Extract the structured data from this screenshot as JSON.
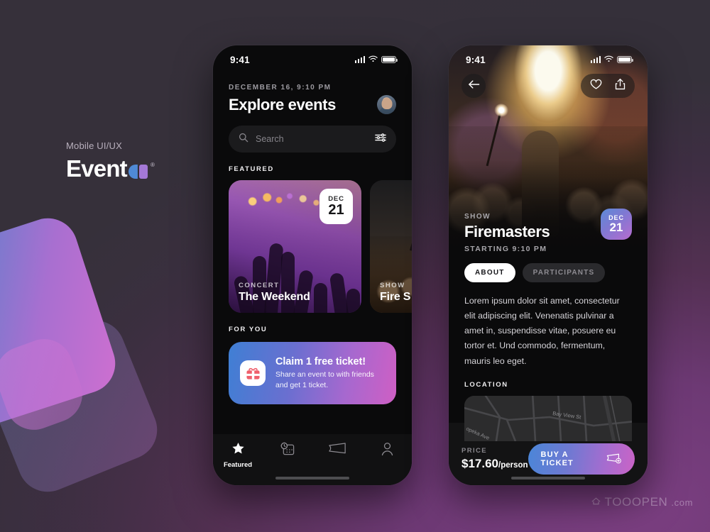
{
  "brand": {
    "kicker": "Mobile UI/UX",
    "name": "Event",
    "registered": "®"
  },
  "watermark": {
    "icon": "cloud-home-icon",
    "name": "TOOOPEN",
    "suffix": ".com"
  },
  "phone_explore": {
    "statusbar": {
      "time": "9:41",
      "signal_icon": "cellular-signal-icon",
      "wifi_icon": "wifi-icon",
      "battery_icon": "battery-icon"
    },
    "header": {
      "date": "DECEMBER 16, 9:10 PM",
      "title": "Explore events",
      "avatar": "user-avatar"
    },
    "search": {
      "placeholder": "Search",
      "search_icon": "search-icon",
      "filter_icon": "filter-sliders-icon"
    },
    "featured": {
      "label": "FEATURED",
      "cards": [
        {
          "kicker": "CONCERT",
          "name": "The Weekend",
          "date_month": "DEC",
          "date_day": "21"
        },
        {
          "kicker": "SHOW",
          "name": "Fire S"
        }
      ]
    },
    "for_you": {
      "label": "FOR YOU",
      "promo": {
        "icon": "gift-ticket-icon",
        "title": "Claim 1 free ticket!",
        "subtitle": "Share an event to with friends and get 1 ticket."
      }
    },
    "tabbar": {
      "items": [
        {
          "icon": "star-icon",
          "label": "Featured",
          "active": true
        },
        {
          "icon": "calendar-clock-icon",
          "label": "",
          "active": false
        },
        {
          "icon": "ticket-icon",
          "label": "",
          "active": false
        },
        {
          "icon": "person-icon",
          "label": "",
          "active": false
        }
      ]
    }
  },
  "phone_detail": {
    "statusbar": {
      "time": "9:41",
      "signal_icon": "cellular-signal-icon",
      "wifi_icon": "wifi-icon",
      "battery_icon": "battery-icon"
    },
    "hero_actions": {
      "back_icon": "back-arrow-icon",
      "favorite_icon": "heart-icon",
      "share_icon": "share-icon"
    },
    "event": {
      "kicker": "SHOW",
      "title": "Firemasters",
      "starting": "STARTING 9:10 PM",
      "date_month": "DEC",
      "date_day": "21"
    },
    "segments": [
      {
        "label": "ABOUT",
        "active": true
      },
      {
        "label": "PARTICIPANTS",
        "active": false
      }
    ],
    "description": "Lorem ipsum dolor sit amet, consectetur elit adipiscing elit. Venenatis pulvinar a amet in, suspendisse vitae, posuere eu tortor et. Und commodo, fermentum, mauris leo eget.",
    "location": {
      "label": "LOCATION",
      "streets": [
        "Bay View St",
        "Topeka Ave"
      ]
    },
    "price_bar": {
      "price_label": "PRICE",
      "price_value": "$17.60",
      "price_unit": "/person",
      "buy_label": "BUY A TICKET",
      "buy_icon": "ticket-add-icon"
    }
  },
  "colors": {
    "background_dark": "#35303a",
    "background_purple": "#713a77",
    "accent_blue": "#4a86d8",
    "accent_purple": "#a66ccf",
    "accent_pink": "#cb63c6",
    "phone_surface": "#0a0a0b"
  }
}
